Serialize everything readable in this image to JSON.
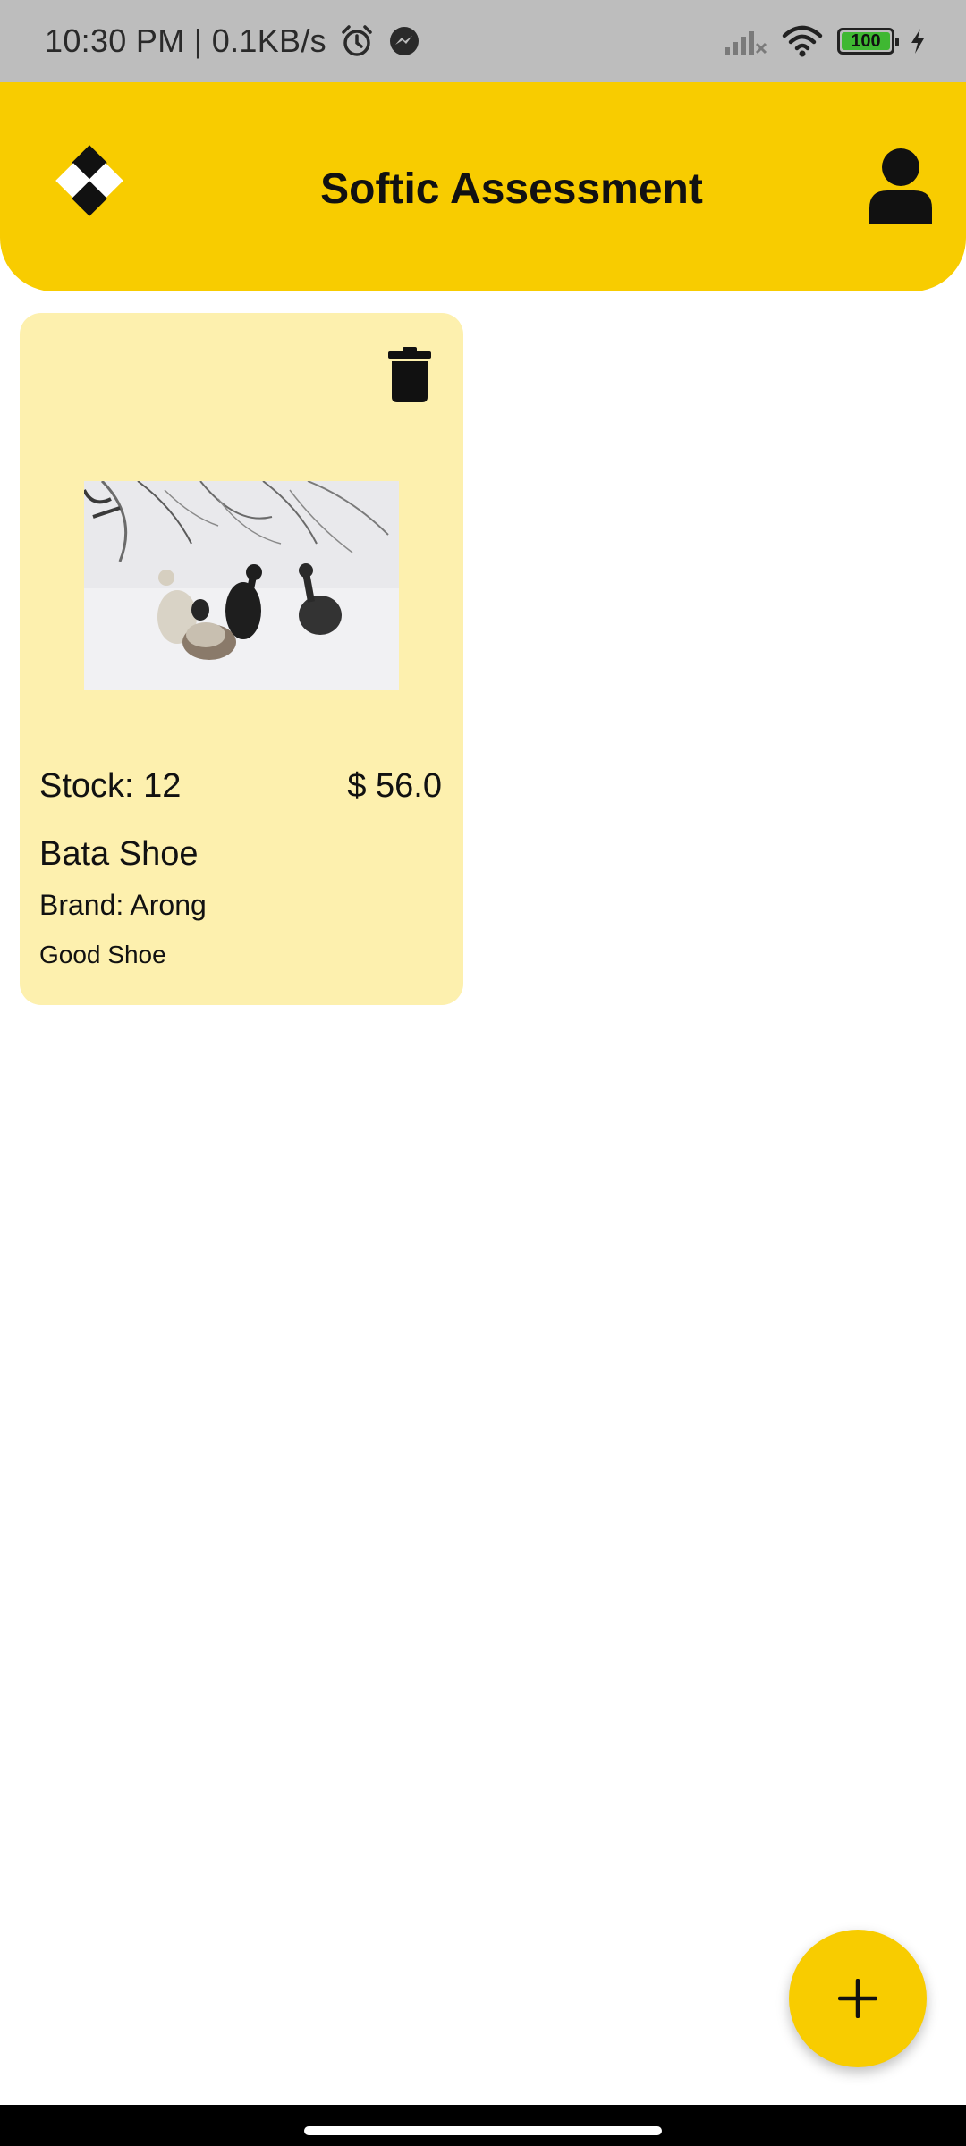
{
  "status_bar": {
    "time": "10:30 PM | 0.1KB/s",
    "battery_level": "100",
    "icons": [
      "alarm-icon",
      "messenger-icon",
      "signal-icon",
      "wifi-icon",
      "battery-icon",
      "charging-icon"
    ]
  },
  "app_bar": {
    "title": "Softic Assessment",
    "logo_icon": "diamond-logo-icon",
    "profile_icon": "person-icon",
    "background_color": "#f8cc00"
  },
  "products": [
    {
      "stock_text": "Stock: 12",
      "price_text": "$ 56.0",
      "name": "Bata Shoe",
      "brand_text": "Brand: Arong",
      "description": "Good Shoe",
      "delete_icon": "trash-icon",
      "card_color": "#fdf0ae"
    }
  ],
  "fab": {
    "icon": "plus-icon"
  }
}
